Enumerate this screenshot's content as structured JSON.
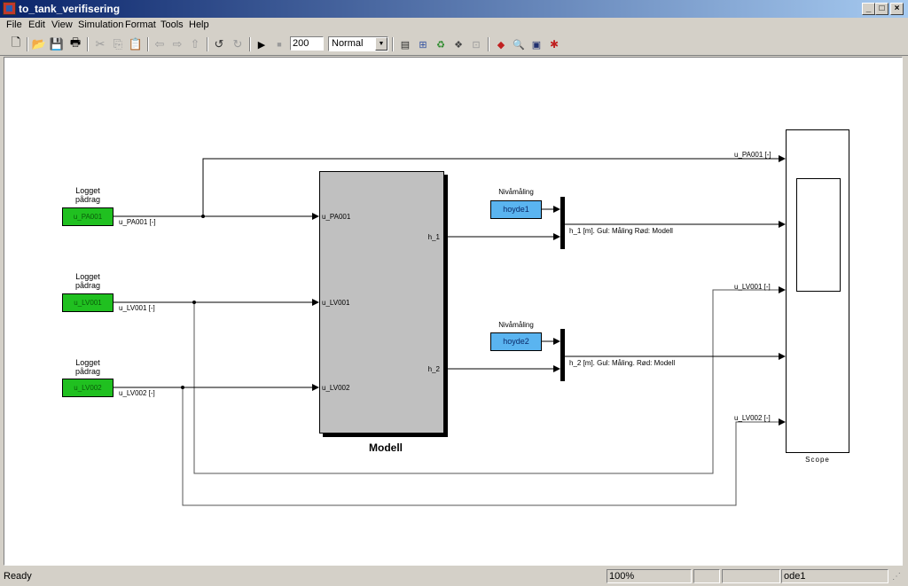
{
  "window": {
    "title": "to_tank_verifisering",
    "controls": {
      "minimize": "_",
      "maximize": "□",
      "close": "×"
    }
  },
  "menu": [
    "File",
    "Edit",
    "View",
    "Simulation",
    "Format",
    "Tools",
    "Help"
  ],
  "toolbar": {
    "icons": {
      "new": "new-model-icon",
      "open": "open-icon",
      "save": "save-icon",
      "print": "print-icon",
      "cut": "cut-icon",
      "copy": "copy-icon",
      "paste": "paste-icon",
      "back": "back-arrow-icon",
      "forward": "forward-arrow-icon",
      "up": "up-arrow-icon",
      "undo": "undo-icon",
      "redo": "redo-icon",
      "start": "start-simulation-icon",
      "stop": "stop-simulation-icon"
    },
    "stop_time": "200",
    "sim_mode": "Normal"
  },
  "diagram": {
    "inputs": [
      {
        "caption_line1": "Logget",
        "caption_line2": "pådrag",
        "name": "u_PA001",
        "signal": "u_PA001 [-]"
      },
      {
        "caption_line1": "Logget",
        "caption_line2": "pådrag",
        "name": "u_LV001",
        "signal": "u_LV001 [-]"
      },
      {
        "caption_line1": "Logget",
        "caption_line2": "pådrag",
        "name": "u_LV002",
        "signal": "u_LV002 [-]"
      }
    ],
    "model": {
      "name": "Modell",
      "in_ports": [
        "u_PA001",
        "u_LV001",
        "u_LV002"
      ],
      "out_ports": [
        "h_1",
        "h_2"
      ]
    },
    "measurements": [
      {
        "caption": "Nivåmåling",
        "name": "hoyde1",
        "mux_signal": "h_1 [m]. Gul: Måling  Rød: Modell"
      },
      {
        "caption": "Nivåmåling",
        "name": "hoyde2",
        "mux_signal": "h_2 [m]. Gul: Måling. Rød: Modell"
      }
    ],
    "scope": {
      "name": "Scope",
      "input_labels": [
        "u_PA001 [-]",
        "u_LV001 [-]",
        "u_LV002 [-]"
      ]
    }
  },
  "status": {
    "text": "Ready",
    "zoom": "100%",
    "pane2": "",
    "pane3": "",
    "solver": "ode1"
  }
}
